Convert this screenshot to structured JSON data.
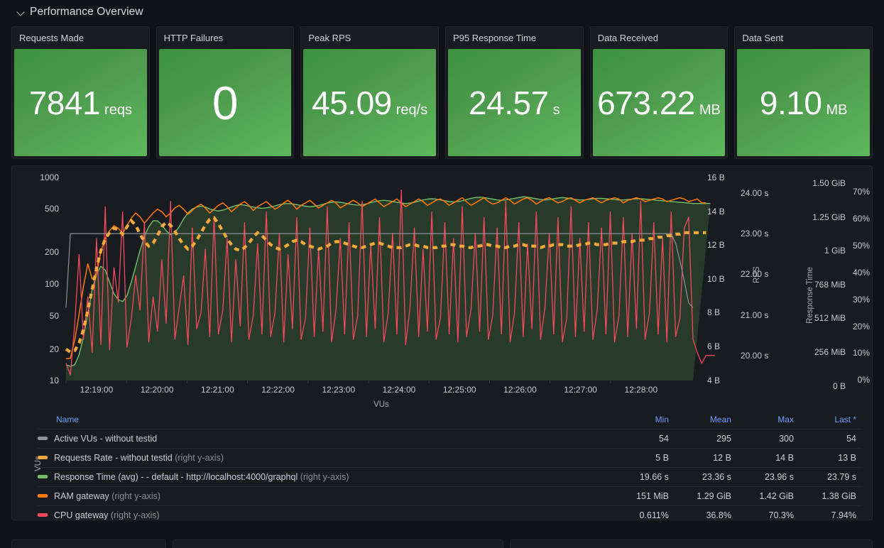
{
  "section": {
    "title": "Performance Overview",
    "collapse_icon": "chevron-down-icon",
    "expanded": true
  },
  "stats": [
    {
      "title": "Requests Made",
      "value": "7841",
      "unit": "reqs",
      "color": "#56a64b",
      "big": false
    },
    {
      "title": "HTTP Failures",
      "value": "0",
      "unit": "",
      "color": "#56a64b",
      "big": true
    },
    {
      "title": "Peak RPS",
      "value": "45.09",
      "unit": "req/s",
      "color": "#56a64b",
      "big": false
    },
    {
      "title": "P95 Response Time",
      "value": "24.57",
      "unit": "s",
      "color": "#56a64b",
      "big": false
    },
    {
      "title": "Data Received",
      "value": "673.22",
      "unit": "MB",
      "color": "#56a64b",
      "big": false
    },
    {
      "title": "Data Sent",
      "value": "9.10",
      "unit": "MB",
      "color": "#56a64b",
      "big": false
    }
  ],
  "chart_data": {
    "type": "line",
    "title": "",
    "xlabel": "VUs",
    "grid": false,
    "legend_position": "bottom-table",
    "x_ticks": [
      "12:19:00",
      "12:20:00",
      "12:21:00",
      "12:22:00",
      "12:23:00",
      "12:24:00",
      "12:25:00",
      "12:26:00",
      "12:27:00",
      "12:28:00"
    ],
    "axes": [
      {
        "name": "VUs",
        "side": "left",
        "scale": "log",
        "ticks": [
          "1000",
          "500",
          "200",
          "100",
          "50",
          "20",
          "10"
        ],
        "label": "VUs"
      },
      {
        "name": "RPS",
        "side": "right",
        "scale": "linear",
        "ticks": [
          "16 B",
          "14 B",
          "12 B",
          "10 B",
          "8 B",
          "6 B",
          "4 B"
        ],
        "label": "RPS"
      },
      {
        "name": "Response Time",
        "side": "right",
        "scale": "linear",
        "ticks": [
          "24.00 s",
          "23.00 s",
          "22.00 s",
          "21.00 s",
          "20.00 s"
        ],
        "label": "Response Time"
      },
      {
        "name": "Memory",
        "side": "right",
        "scale": "linear",
        "ticks": [
          "1.50 GiB",
          "1.25 GiB",
          "1 GiB",
          "768 MiB",
          "512 MiB",
          "256 MiB",
          "0 B"
        ],
        "label": ""
      },
      {
        "name": "CPU",
        "side": "right",
        "scale": "linear",
        "ticks": [
          "70%",
          "60%",
          "50%",
          "40%",
          "30%",
          "20%",
          "10%",
          "0%"
        ],
        "label": ""
      }
    ],
    "series": [
      {
        "name": "Active VUs - without testid",
        "color": "#8e9096",
        "style": "solid",
        "axis": "VUs",
        "min": "54",
        "mean": "295",
        "max": "300",
        "last": "54",
        "values": [
          54,
          300,
          300,
          300,
          300,
          300,
          300,
          300,
          300,
          300,
          300,
          300,
          300,
          300,
          300,
          300,
          300,
          300,
          300,
          300,
          300,
          300,
          300,
          300,
          300,
          300,
          300,
          300,
          300,
          300,
          300,
          300,
          300,
          300,
          300,
          300,
          300,
          300,
          300,
          300,
          300,
          300,
          300,
          300,
          300,
          300,
          300,
          300,
          300,
          300,
          300,
          300,
          300,
          300,
          300,
          300,
          300,
          300,
          300,
          300,
          300,
          300,
          300,
          300,
          300,
          300,
          300,
          300,
          300,
          300,
          300,
          300,
          300,
          300,
          300,
          300,
          300,
          300,
          300,
          300,
          300,
          300,
          300,
          300,
          300,
          300,
          300,
          300,
          300,
          300,
          300,
          300,
          300,
          300,
          300,
          300,
          300,
          300,
          300,
          300,
          300,
          300,
          300,
          300,
          300,
          300,
          300,
          300,
          300,
          300,
          300,
          300,
          300,
          300,
          300,
          300,
          300,
          300,
          300,
          300,
          300,
          300,
          300,
          300,
          300,
          300,
          300,
          300,
          300,
          300,
          300,
          300,
          300,
          300,
          300,
          300,
          300,
          300,
          300,
          300,
          240,
          160,
          100,
          60,
          54
        ]
      },
      {
        "name": "Requests Rate - without testid",
        "color": "#f2a93b",
        "style": "dashed",
        "axis": "RPS",
        "right_axis": true,
        "min": "5 B",
        "mean": "12 B",
        "max": "14 B",
        "last": "13 B",
        "values": [
          5.2,
          5.0,
          5.1,
          5.6,
          6.5,
          7.8,
          9.2,
          10.6,
          11.8,
          12.6,
          13.0,
          13.3,
          13.2,
          12.9,
          13.4,
          13.8,
          13.5,
          12.9,
          12.4,
          12.1,
          12.3,
          12.8,
          13.4,
          13.7,
          13.5,
          13.1,
          12.6,
          12.2,
          11.9,
          12.1,
          12.5,
          13.0,
          13.5,
          13.9,
          14.0,
          13.6,
          13.1,
          12.6,
          12.2,
          11.9,
          11.8,
          12.0,
          12.3,
          12.7,
          13.0,
          12.8,
          12.5,
          12.2,
          12.0,
          11.9,
          12.0,
          12.2,
          12.4,
          12.5,
          12.4,
          12.2,
          12.1,
          12.0,
          11.9,
          12.0,
          12.1,
          12.3,
          12.4,
          12.4,
          12.3,
          12.2,
          12.1,
          12.0,
          12.0,
          12.1,
          12.2,
          12.3,
          12.3,
          12.2,
          12.1,
          12.0,
          12.0,
          12.0,
          12.1,
          12.2,
          12.2,
          12.1,
          12.1,
          12.0,
          12.0,
          12.0,
          12.1,
          12.1,
          12.2,
          12.2,
          12.1,
          12.1,
          12.0,
          12.0,
          12.1,
          12.1,
          12.2,
          12.2,
          12.1,
          12.1,
          12.0,
          12.0,
          12.1,
          12.1,
          12.2,
          12.2,
          12.1,
          12.1,
          12.1,
          12.0,
          12.1,
          12.1,
          12.2,
          12.2,
          12.2,
          12.1,
          12.1,
          12.1,
          12.2,
          12.2,
          12.3,
          12.3,
          12.2,
          12.2,
          12.2,
          12.3,
          12.3,
          12.3,
          12.4,
          12.4,
          12.4,
          12.5,
          12.5,
          12.5,
          12.6,
          12.6,
          12.7,
          12.7,
          12.8,
          12.8,
          12.9,
          12.9,
          13.0,
          13.0,
          13.0,
          13.0,
          13.0,
          13.0
        ]
      },
      {
        "name": "Response Time (avg) - - default - http://localhost:4000/graphql",
        "color": "#73bf69",
        "style": "solid-area",
        "axis": "Response Time",
        "right_axis": true,
        "min": "19.66 s",
        "mean": "23.36 s",
        "max": "23.96 s",
        "last": "23.79 s",
        "values": [
          19.7,
          19.66,
          19.7,
          19.95,
          20.4,
          21.0,
          21.6,
          22.0,
          22.2,
          22.1,
          21.8,
          21.5,
          21.35,
          21.3,
          21.45,
          21.8,
          22.2,
          22.6,
          22.95,
          23.2,
          23.35,
          23.35,
          23.25,
          23.1,
          23.0,
          23.05,
          23.2,
          23.4,
          23.55,
          23.65,
          23.7,
          23.72,
          23.7,
          23.65,
          23.62,
          23.6,
          23.62,
          23.66,
          23.7,
          23.74,
          23.76,
          23.75,
          23.72,
          23.7,
          23.68,
          23.67,
          23.68,
          23.7,
          23.73,
          23.76,
          23.78,
          23.79,
          23.78,
          23.76,
          23.74,
          23.72,
          23.71,
          23.72,
          23.74,
          23.77,
          23.8,
          23.82,
          23.83,
          23.82,
          23.8,
          23.78,
          23.76,
          23.75,
          23.76,
          23.78,
          23.81,
          23.84,
          23.86,
          23.87,
          23.86,
          23.84,
          23.82,
          23.8,
          23.79,
          23.8,
          23.82,
          23.85,
          23.88,
          23.9,
          23.91,
          23.9,
          23.88,
          23.86,
          23.84,
          23.83,
          23.84,
          23.86,
          23.89,
          23.92,
          23.94,
          23.95,
          23.94,
          23.92,
          23.9,
          23.88,
          23.87,
          23.88,
          23.9,
          23.92,
          23.94,
          23.96,
          23.95,
          23.93,
          23.91,
          23.89,
          23.88,
          23.89,
          23.91,
          23.93,
          23.94,
          23.93,
          23.91,
          23.89,
          23.88,
          23.88,
          23.89,
          23.91,
          23.92,
          23.92,
          23.91,
          23.9,
          23.89,
          23.88,
          23.88,
          23.89,
          23.9,
          23.91,
          23.91,
          23.9,
          23.89,
          23.88,
          23.87,
          23.86,
          23.85,
          23.84,
          23.83,
          23.82,
          23.81,
          23.8,
          23.79,
          23.79,
          23.79,
          23.79,
          23.79
        ]
      },
      {
        "name": "RAM gateway",
        "color": "#ff780a",
        "style": "solid",
        "axis": "Memory",
        "right_axis": true,
        "min": "151 MiB",
        "mean": "1.29 GiB",
        "max": "1.42 GiB",
        "last": "1.38 GiB",
        "values": [
          0.151,
          0.155,
          0.3,
          0.5,
          0.72,
          0.9,
          0.78,
          0.82,
          1.0,
          1.1,
          1.16,
          1.2,
          1.18,
          1.14,
          1.2,
          1.26,
          1.3,
          1.27,
          1.22,
          1.26,
          1.3,
          1.33,
          1.31,
          1.27,
          1.3,
          1.34,
          1.36,
          1.33,
          1.29,
          1.32,
          1.35,
          1.37,
          1.34,
          1.3,
          1.33,
          1.36,
          1.38,
          1.35,
          1.31,
          1.34,
          1.37,
          1.39,
          1.36,
          1.32,
          1.35,
          1.37,
          1.39,
          1.36,
          1.33,
          1.35,
          1.38,
          1.4,
          1.37,
          1.33,
          1.36,
          1.38,
          1.4,
          1.37,
          1.34,
          1.36,
          1.38,
          1.4,
          1.38,
          1.34,
          1.36,
          1.38,
          1.4,
          1.38,
          1.35,
          1.37,
          1.39,
          1.41,
          1.38,
          1.35,
          1.37,
          1.39,
          1.41,
          1.38,
          1.35,
          1.37,
          1.39,
          1.41,
          1.39,
          1.36,
          1.38,
          1.4,
          1.41,
          1.39,
          1.36,
          1.38,
          1.4,
          1.42,
          1.39,
          1.36,
          1.38,
          1.4,
          1.42,
          1.39,
          1.37,
          1.38,
          1.4,
          1.42,
          1.4,
          1.37,
          1.39,
          1.41,
          1.42,
          1.4,
          1.37,
          1.39,
          1.41,
          1.42,
          1.4,
          1.38,
          1.39,
          1.41,
          1.42,
          1.4,
          1.38,
          1.4,
          1.41,
          1.42,
          1.4,
          1.38,
          1.4,
          1.41,
          1.42,
          1.41,
          1.38,
          1.4,
          1.41,
          1.42,
          1.41,
          1.39,
          1.4,
          1.41,
          1.42,
          1.41,
          1.39,
          1.4,
          1.41,
          1.42,
          1.41,
          1.39,
          1.4,
          1.41,
          1.38,
          1.38
        ]
      },
      {
        "name": "CPU gateway",
        "color": "#f2495c",
        "style": "solid",
        "axis": "CPU",
        "right_axis": true,
        "min": "0.611%",
        "mean": "36.8%",
        "max": "70.3%",
        "last": "7.94%",
        "values": [
          5.0,
          0.611,
          20.0,
          46.0,
          14.0,
          30.0,
          9.0,
          52.0,
          12.0,
          64.0,
          10.0,
          41.0,
          28.0,
          62.0,
          11.0,
          22.0,
          38.0,
          25.0,
          58.0,
          13.0,
          30.0,
          17.0,
          44.0,
          20.0,
          66.0,
          14.0,
          26.0,
          38.0,
          12.0,
          56.0,
          18.0,
          24.0,
          48.0,
          15.0,
          60.0,
          16.0,
          25.0,
          52.0,
          13.0,
          44.0,
          19.0,
          58.0,
          14.0,
          23.0,
          50.0,
          16.0,
          62.0,
          15.0,
          24.0,
          54.0,
          13.0,
          46.0,
          18.0,
          60.0,
          14.0,
          22.0,
          56.0,
          15.0,
          48.0,
          17.0,
          64.0,
          13.0,
          25.0,
          52.0,
          16.0,
          58.0,
          14.0,
          23.0,
          66.0,
          15.0,
          50.0,
          18.0,
          60.0,
          13.0,
          24.0,
          54.0,
          16.0,
          70.3,
          12.0,
          26.0,
          56.0,
          15.0,
          48.0,
          17.0,
          62.0,
          14.0,
          22.0,
          58.0,
          16.0,
          52.0,
          13.0,
          64.0,
          15.0,
          25.0,
          54.0,
          17.0,
          60.0,
          14.0,
          23.0,
          56.0,
          16.0,
          66.0,
          13.0,
          24.0,
          58.0,
          15.0,
          50.0,
          18.0,
          62.0,
          14.0,
          26.0,
          54.0,
          16.0,
          60.0,
          13.0,
          22.0,
          64.0,
          15.0,
          52.0,
          17.0,
          58.0,
          14.0,
          25.0,
          56.0,
          16.0,
          62.0,
          13.0,
          23.0,
          60.0,
          15.0,
          54.0,
          18.0,
          66.0,
          14.0,
          24.0,
          58.0,
          16.0,
          52.0,
          13.0,
          62.0,
          15.0,
          22.0,
          56.0,
          60.0,
          14.0,
          9.0,
          5.0,
          7.94,
          7.94,
          7.94
        ]
      }
    ]
  },
  "legend_table": {
    "columns": [
      "Name",
      "Min",
      "Mean",
      "Max",
      "Last *"
    ],
    "rows": [
      {
        "name": "Active VUs - without testid",
        "axis_note": "",
        "color": "#8e9096",
        "min": "54",
        "mean": "295",
        "max": "300",
        "last": "54"
      },
      {
        "name": "Requests Rate - without testid",
        "axis_note": "(right y-axis)",
        "color": "#f2a93b",
        "min": "5 B",
        "mean": "12 B",
        "max": "14 B",
        "last": "13 B"
      },
      {
        "name": "Response Time (avg) - - default - http://localhost:4000/graphql",
        "axis_note": "(right y-axis)",
        "color": "#73bf69",
        "min": "19.66 s",
        "mean": "23.36 s",
        "max": "23.96 s",
        "last": "23.79 s"
      },
      {
        "name": "RAM gateway",
        "axis_note": "(right y-axis)",
        "color": "#ff780a",
        "min": "151 MiB",
        "mean": "1.29 GiB",
        "max": "1.42 GiB",
        "last": "1.38 GiB"
      },
      {
        "name": "CPU gateway",
        "axis_note": "(right y-axis)",
        "color": "#f2495c",
        "min": "0.611%",
        "mean": "36.8%",
        "max": "70.3%",
        "last": "7.94%"
      }
    ]
  }
}
